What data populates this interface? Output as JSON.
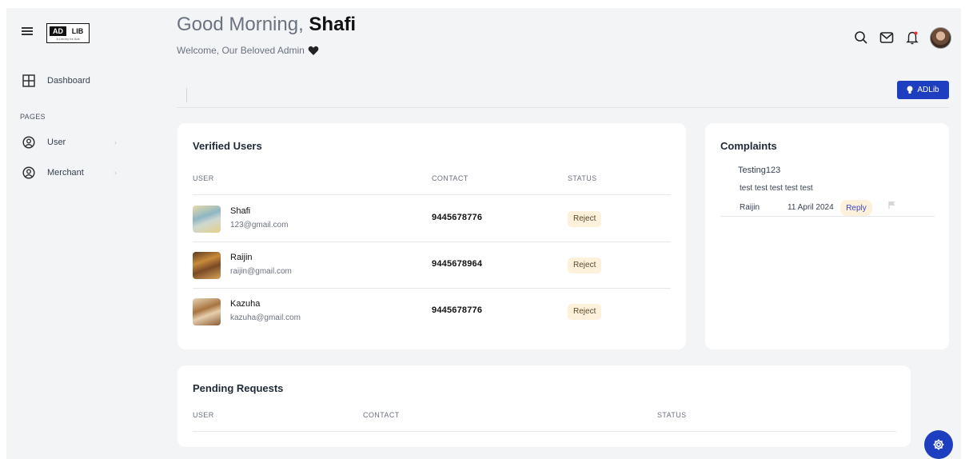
{
  "brand": {
    "logo_left": "AD",
    "logo_right": "LIB",
    "tagline": "A Library for Ads"
  },
  "sidebar": {
    "dashboard_label": "Dashboard",
    "section_label": "PAGES",
    "items": [
      {
        "label": "User",
        "chevron": "›",
        "icon": "user-circle-icon"
      },
      {
        "label": "Merchant",
        "chevron": "›",
        "icon": "user-circle-icon"
      }
    ]
  },
  "header": {
    "greeting": "Good Morning, ",
    "user_name": "Shafi",
    "welcome": "Welcome, Our Beloved Admin",
    "adlib_button": "ADLib"
  },
  "verified_users": {
    "title": "Verified Users",
    "columns": {
      "user": "USER",
      "contact": "CONTACT",
      "status": "STATUS"
    },
    "rows": [
      {
        "name": "Shafi",
        "email": "123@gmail.com",
        "contact": "9445678776",
        "status": "Reject"
      },
      {
        "name": "Raijin",
        "email": "raijin@gmail.com",
        "contact": "9445678964",
        "status": "Reject"
      },
      {
        "name": "Kazuha",
        "email": "kazuha@gmail.com",
        "contact": "9445678776",
        "status": "Reject"
      }
    ]
  },
  "complaints": {
    "title": "Complaints",
    "items": [
      {
        "subject": "Testing123",
        "body": "test test test test test",
        "user": "Raijin",
        "date": "11 April 2024",
        "action": "Reply"
      }
    ]
  },
  "pending_requests": {
    "title": "Pending Requests",
    "columns": {
      "user": "USER",
      "contact": "CONTACT",
      "status": "STATUS"
    }
  },
  "colors": {
    "accent": "#1d3fbf",
    "background": "#f3f4f6",
    "badge": "#fdf1dc"
  }
}
